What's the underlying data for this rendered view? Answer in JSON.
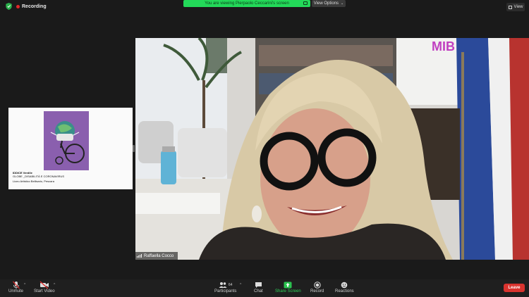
{
  "top": {
    "recording_label": "Recording",
    "viewing_banner": "You are viewing Pierpaolo Ceccarini's screen",
    "view_options_label": "View Options",
    "view_label": "View"
  },
  "shared_slide": {
    "caption_line1": "IDDICE  Verdile",
    "caption_line2": "GLOBE _DISABILITÀ E CORONAVIRUS",
    "caption_line3": "Liceo Artistico Bellisario, Pescara"
  },
  "video": {
    "participant_name": "Raffaella Cocco",
    "banner_text": "MIB"
  },
  "toolbar": {
    "unmute_label": "Unmute",
    "start_video_label": "Start Video",
    "participants_label": "Participants",
    "participants_count": "64",
    "chat_label": "Chat",
    "share_screen_label": "Share Screen",
    "record_label": "Record",
    "reactions_label": "Reactions",
    "leave_label": "Leave"
  },
  "colors": {
    "share_green": "#23d959",
    "leave_red": "#d9332e",
    "record_red": "#e02828"
  },
  "icons": [
    "shield-icon",
    "record-dot-icon",
    "chevron-down-icon",
    "grid-icon",
    "mic-muted-icon",
    "video-off-icon",
    "participants-icon",
    "chat-icon",
    "share-screen-icon",
    "record-icon",
    "reactions-icon",
    "signal-icon"
  ]
}
